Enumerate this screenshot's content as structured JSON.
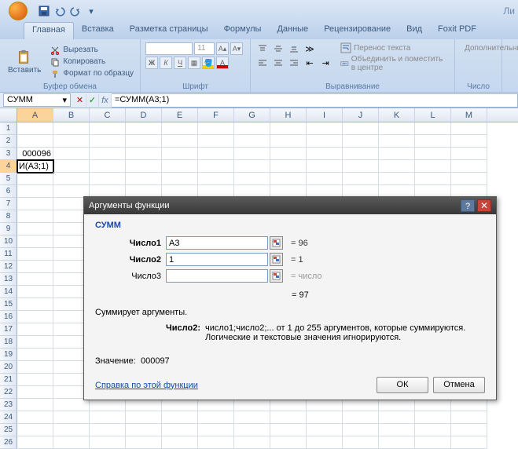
{
  "title_right": "Ли",
  "tabs": {
    "home": "Главная",
    "insert": "Вставка",
    "layout": "Разметка страницы",
    "formulas": "Формулы",
    "data": "Данные",
    "review": "Рецензирование",
    "view": "Вид",
    "foxit": "Foxit PDF"
  },
  "ribbon": {
    "paste": "Вставить",
    "cut": "Вырезать",
    "copy": "Копировать",
    "format_painter": "Формат по образцу",
    "clipboard_label": "Буфер обмена",
    "font_label": "Шрифт",
    "font_size": "11",
    "alignment_label": "Выравнивание",
    "wrap": "Перенос текста",
    "merge": "Объединить и поместить в центре",
    "number_label": "Число",
    "additional": "Дополнительны"
  },
  "formula_bar": {
    "name_box": "СУММ",
    "formula": "=СУММ(A3;1)"
  },
  "columns": [
    "A",
    "B",
    "C",
    "D",
    "E",
    "F",
    "G",
    "H",
    "I",
    "J",
    "K",
    "L",
    "M"
  ],
  "cells": {
    "a3": "000096",
    "a4": "И(A3;1)"
  },
  "dialog": {
    "title": "Аргументы функции",
    "fn": "СУММ",
    "arg1_label": "Число1",
    "arg1_value": "A3",
    "arg1_result": "= 96",
    "arg2_label": "Число2",
    "arg2_value": "1",
    "arg2_result": "= 1",
    "arg3_label": "Число3",
    "arg3_value": "",
    "arg3_result": "= число",
    "total": "= 97",
    "desc": "Суммирует аргументы.",
    "argdesc_label": "Число2:",
    "argdesc_text": "число1;число2;... от 1 до 255 аргументов, которые суммируются. Логические и текстовые значения игнорируются.",
    "value_label": "Значение:",
    "value": "000097",
    "help": "Справка по этой функции",
    "ok": "ОК",
    "cancel": "Отмена"
  }
}
